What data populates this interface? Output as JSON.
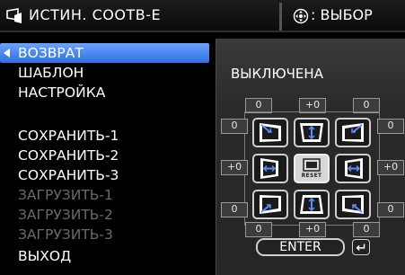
{
  "header": {
    "title": "ИСТИН. СООТВ-Е",
    "select_label": ": ВЫБОР",
    "logo_icon": "keystone-icon",
    "select_icon": "dpad-icon"
  },
  "menu": {
    "items": [
      {
        "label": "ВОЗВРАТ",
        "state": "active"
      },
      {
        "label": "ШАБЛОН",
        "state": "normal"
      },
      {
        "label": "НАСТРОЙКА",
        "state": "normal"
      },
      {
        "label": "СОХРАНИТЬ-1",
        "state": "normal"
      },
      {
        "label": "СОХРАНИТЬ-2",
        "state": "normal"
      },
      {
        "label": "СОХРАНИТЬ-3",
        "state": "normal"
      },
      {
        "label": "ЗАГРУЗИТЬ-1",
        "state": "disabled"
      },
      {
        "label": "ЗАГРУЗИТЬ-2",
        "state": "disabled"
      },
      {
        "label": "ЗАГРУЗИТЬ-3",
        "state": "disabled"
      },
      {
        "label": "ВЫХОД",
        "state": "normal"
      }
    ]
  },
  "panel": {
    "status": "ВЫКЛЮЧЕНА",
    "values": {
      "top_left": "0",
      "top_center": "+0",
      "top_right": "0",
      "upper_left_side": "0",
      "upper_right_side": "0",
      "mid_left": "+0",
      "mid_right": "+0",
      "lower_left_side": "0",
      "lower_right_side": "0",
      "bottom_left": "0",
      "bottom_center": "+0",
      "bottom_right": "0"
    },
    "reset_label": "RESET",
    "enter_label": "ENTER"
  },
  "colors": {
    "highlight": "#3a7af0",
    "disabled_text": "#6a6a6a",
    "panel_bg": "#2c2c2c"
  }
}
